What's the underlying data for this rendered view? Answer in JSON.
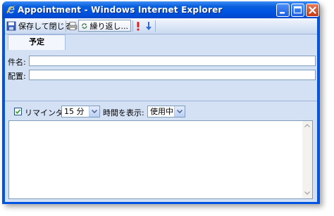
{
  "window": {
    "title": "Appointment - Windows Internet Explorer",
    "icon": "internet-explorer-icon"
  },
  "toolbar": {
    "save_close_label": "保存して閉じる",
    "repeat_label": "繰り返し...",
    "icons": [
      "save-icon",
      "print-icon",
      "recurrence-icon",
      "high-importance-icon",
      "low-importance-icon"
    ]
  },
  "tabs": [
    {
      "label": "予定",
      "selected": true
    }
  ],
  "form": {
    "subject_label": "件名:",
    "subject_value": "",
    "location_label": "配置:",
    "location_value": ""
  },
  "reminder": {
    "checked": true,
    "label": "リマインダ",
    "time_value": "15 分",
    "show_time_label": "時間を表示:",
    "show_time_value": "使用中"
  },
  "notes": {
    "value": ""
  },
  "colors": {
    "title_bar": "#0054e3",
    "panel_bg": "#d4e1f5",
    "border": "#7f9db9",
    "high_importance": "#e0201b",
    "low_importance": "#2f6ad8"
  }
}
